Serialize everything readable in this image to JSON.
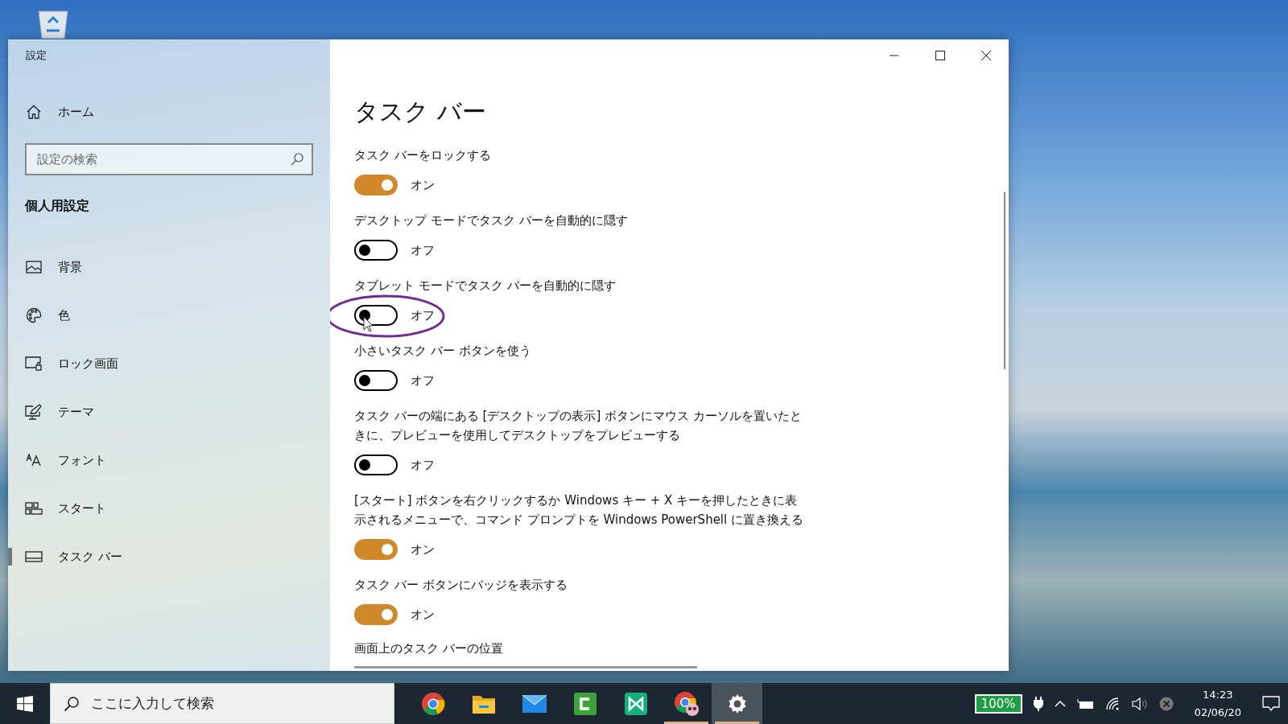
{
  "window": {
    "title": "設定"
  },
  "sidebar": {
    "home": "ホーム",
    "search": {
      "placeholder": "設定の検索"
    },
    "section": "個人用設定",
    "items": [
      {
        "kind": "background",
        "label": "背景",
        "selected": false
      },
      {
        "kind": "colors",
        "label": "色",
        "selected": false
      },
      {
        "kind": "lockscreen",
        "label": "ロック画面",
        "selected": false
      },
      {
        "kind": "theme",
        "label": "テーマ",
        "selected": false
      },
      {
        "kind": "fonts",
        "label": "フォント",
        "selected": false
      },
      {
        "kind": "start",
        "label": "スタート",
        "selected": false
      },
      {
        "kind": "taskbar",
        "label": "タスク バー",
        "selected": true
      }
    ]
  },
  "page": {
    "title": "タスク バー",
    "settings": [
      {
        "label": "タスク バーをロックする",
        "on": true,
        "state_text": "オン",
        "highlighted": false
      },
      {
        "label": "デスクトップ モードでタスク バーを自動的に隠す",
        "on": false,
        "state_text": "オフ",
        "highlighted": false
      },
      {
        "label": "タブレット モードでタスク バーを自動的に隠す",
        "on": false,
        "state_text": "オフ",
        "highlighted": true
      },
      {
        "label": "小さいタスク バー ボタンを使う",
        "on": false,
        "state_text": "オフ",
        "highlighted": false
      },
      {
        "label": "タスク バーの端にある [デスクトップの表示] ボタンにマウス カーソルを置いたときに、プレビューを使用してデスクトップをプレビューする",
        "on": false,
        "state_text": "オフ",
        "highlighted": false
      },
      {
        "label": "[スタート] ボタンを右クリックするか Windows キー + X キーを押したときに表示されるメニューで、コマンド プロンプトを Windows PowerShell に置き換える",
        "on": true,
        "state_text": "オン",
        "highlighted": false
      },
      {
        "label": "タスク バー ボタンにバッジを表示する",
        "on": true,
        "state_text": "オン",
        "highlighted": false
      }
    ],
    "position_label": "画面上のタスク バーの位置"
  },
  "taskbar": {
    "search_placeholder": "ここに入力して検索",
    "apps": [
      {
        "kind": "chrome",
        "running": false,
        "selected": false
      },
      {
        "kind": "explorer",
        "running": false,
        "selected": false
      },
      {
        "kind": "mail",
        "running": false,
        "selected": false
      },
      {
        "kind": "camtasia",
        "running": false,
        "selected": false
      },
      {
        "kind": "xmind",
        "running": false,
        "selected": false
      },
      {
        "kind": "chrome-profile",
        "running": true,
        "selected": false
      },
      {
        "kind": "settings",
        "running": true,
        "selected": true
      }
    ],
    "battery": "100%",
    "time": "14:23",
    "date": "02/06/20"
  }
}
